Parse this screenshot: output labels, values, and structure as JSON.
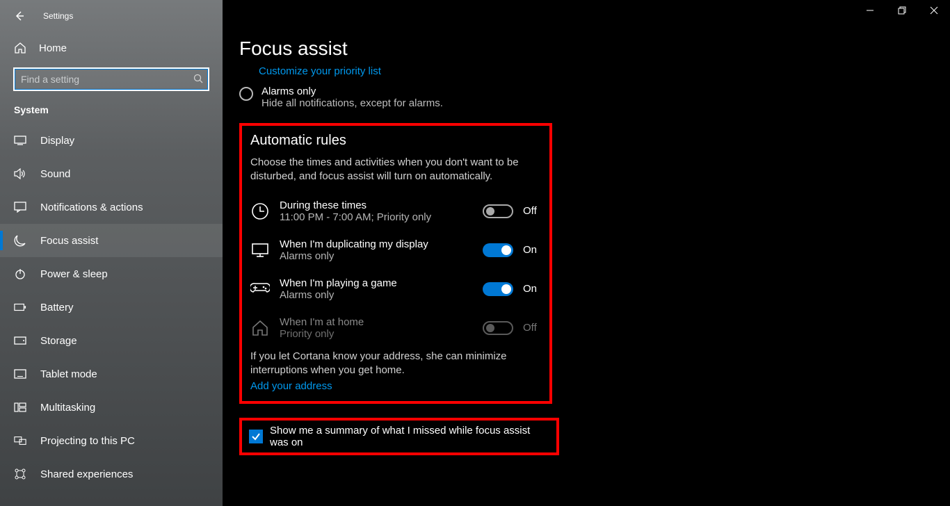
{
  "titlebar": {
    "settings_label": "Settings"
  },
  "sidebar": {
    "home_label": "Home",
    "search_placeholder": "Find a setting",
    "section_header": "System",
    "items": [
      {
        "label": "Display"
      },
      {
        "label": "Sound"
      },
      {
        "label": "Notifications & actions"
      },
      {
        "label": "Focus assist"
      },
      {
        "label": "Power & sleep"
      },
      {
        "label": "Battery"
      },
      {
        "label": "Storage"
      },
      {
        "label": "Tablet mode"
      },
      {
        "label": "Multitasking"
      },
      {
        "label": "Projecting to this PC"
      },
      {
        "label": "Shared experiences"
      }
    ]
  },
  "page": {
    "title": "Focus assist",
    "priority_link": "Customize your priority list",
    "alarms_only": {
      "title": "Alarms only",
      "desc": "Hide all notifications, except for alarms."
    },
    "rules": {
      "heading": "Automatic rules",
      "desc": "Choose the times and activities when you don't want to be disturbed, and focus assist will turn on automatically.",
      "items": [
        {
          "title": "During these times",
          "subtitle": "11:00 PM - 7:00 AM; Priority only",
          "state": "Off"
        },
        {
          "title": "When I'm duplicating my display",
          "subtitle": "Alarms only",
          "state": "On"
        },
        {
          "title": "When I'm playing a game",
          "subtitle": "Alarms only",
          "state": "On"
        },
        {
          "title": "When I'm at home",
          "subtitle": "Priority only",
          "state": "Off"
        }
      ],
      "cortana_note": "If you let Cortana know your address, she can minimize interruptions when you get home.",
      "address_link": "Add your address"
    },
    "summary_checkbox_label": "Show me a summary of what I missed while focus assist was on"
  }
}
